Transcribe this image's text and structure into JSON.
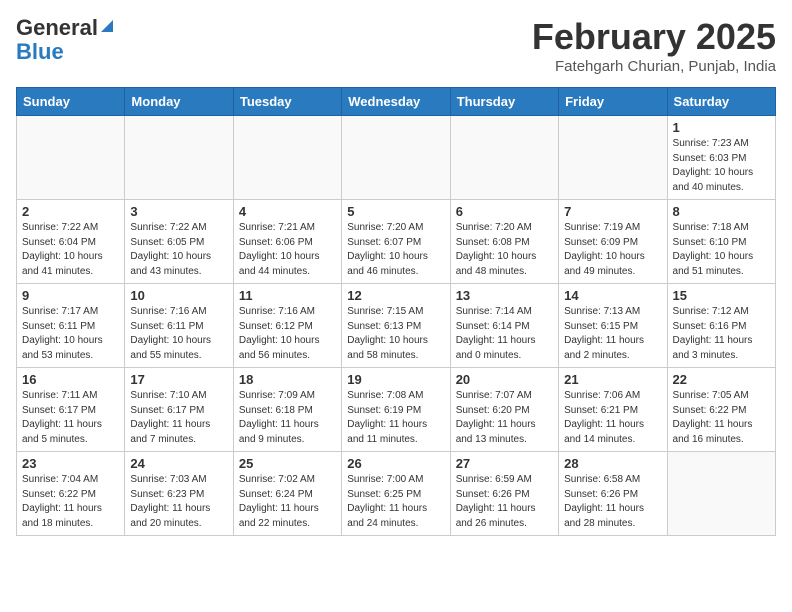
{
  "header": {
    "logo_general": "General",
    "logo_blue": "Blue",
    "title": "February 2025",
    "subtitle": "Fatehgarh Churian, Punjab, India"
  },
  "weekdays": [
    "Sunday",
    "Monday",
    "Tuesday",
    "Wednesday",
    "Thursday",
    "Friday",
    "Saturday"
  ],
  "weeks": [
    [
      {
        "day": "",
        "info": ""
      },
      {
        "day": "",
        "info": ""
      },
      {
        "day": "",
        "info": ""
      },
      {
        "day": "",
        "info": ""
      },
      {
        "day": "",
        "info": ""
      },
      {
        "day": "",
        "info": ""
      },
      {
        "day": "1",
        "info": "Sunrise: 7:23 AM\nSunset: 6:03 PM\nDaylight: 10 hours\nand 40 minutes."
      }
    ],
    [
      {
        "day": "2",
        "info": "Sunrise: 7:22 AM\nSunset: 6:04 PM\nDaylight: 10 hours\nand 41 minutes."
      },
      {
        "day": "3",
        "info": "Sunrise: 7:22 AM\nSunset: 6:05 PM\nDaylight: 10 hours\nand 43 minutes."
      },
      {
        "day": "4",
        "info": "Sunrise: 7:21 AM\nSunset: 6:06 PM\nDaylight: 10 hours\nand 44 minutes."
      },
      {
        "day": "5",
        "info": "Sunrise: 7:20 AM\nSunset: 6:07 PM\nDaylight: 10 hours\nand 46 minutes."
      },
      {
        "day": "6",
        "info": "Sunrise: 7:20 AM\nSunset: 6:08 PM\nDaylight: 10 hours\nand 48 minutes."
      },
      {
        "day": "7",
        "info": "Sunrise: 7:19 AM\nSunset: 6:09 PM\nDaylight: 10 hours\nand 49 minutes."
      },
      {
        "day": "8",
        "info": "Sunrise: 7:18 AM\nSunset: 6:10 PM\nDaylight: 10 hours\nand 51 minutes."
      }
    ],
    [
      {
        "day": "9",
        "info": "Sunrise: 7:17 AM\nSunset: 6:11 PM\nDaylight: 10 hours\nand 53 minutes."
      },
      {
        "day": "10",
        "info": "Sunrise: 7:16 AM\nSunset: 6:11 PM\nDaylight: 10 hours\nand 55 minutes."
      },
      {
        "day": "11",
        "info": "Sunrise: 7:16 AM\nSunset: 6:12 PM\nDaylight: 10 hours\nand 56 minutes."
      },
      {
        "day": "12",
        "info": "Sunrise: 7:15 AM\nSunset: 6:13 PM\nDaylight: 10 hours\nand 58 minutes."
      },
      {
        "day": "13",
        "info": "Sunrise: 7:14 AM\nSunset: 6:14 PM\nDaylight: 11 hours\nand 0 minutes."
      },
      {
        "day": "14",
        "info": "Sunrise: 7:13 AM\nSunset: 6:15 PM\nDaylight: 11 hours\nand 2 minutes."
      },
      {
        "day": "15",
        "info": "Sunrise: 7:12 AM\nSunset: 6:16 PM\nDaylight: 11 hours\nand 3 minutes."
      }
    ],
    [
      {
        "day": "16",
        "info": "Sunrise: 7:11 AM\nSunset: 6:17 PM\nDaylight: 11 hours\nand 5 minutes."
      },
      {
        "day": "17",
        "info": "Sunrise: 7:10 AM\nSunset: 6:17 PM\nDaylight: 11 hours\nand 7 minutes."
      },
      {
        "day": "18",
        "info": "Sunrise: 7:09 AM\nSunset: 6:18 PM\nDaylight: 11 hours\nand 9 minutes."
      },
      {
        "day": "19",
        "info": "Sunrise: 7:08 AM\nSunset: 6:19 PM\nDaylight: 11 hours\nand 11 minutes."
      },
      {
        "day": "20",
        "info": "Sunrise: 7:07 AM\nSunset: 6:20 PM\nDaylight: 11 hours\nand 13 minutes."
      },
      {
        "day": "21",
        "info": "Sunrise: 7:06 AM\nSunset: 6:21 PM\nDaylight: 11 hours\nand 14 minutes."
      },
      {
        "day": "22",
        "info": "Sunrise: 7:05 AM\nSunset: 6:22 PM\nDaylight: 11 hours\nand 16 minutes."
      }
    ],
    [
      {
        "day": "23",
        "info": "Sunrise: 7:04 AM\nSunset: 6:22 PM\nDaylight: 11 hours\nand 18 minutes."
      },
      {
        "day": "24",
        "info": "Sunrise: 7:03 AM\nSunset: 6:23 PM\nDaylight: 11 hours\nand 20 minutes."
      },
      {
        "day": "25",
        "info": "Sunrise: 7:02 AM\nSunset: 6:24 PM\nDaylight: 11 hours\nand 22 minutes."
      },
      {
        "day": "26",
        "info": "Sunrise: 7:00 AM\nSunset: 6:25 PM\nDaylight: 11 hours\nand 24 minutes."
      },
      {
        "day": "27",
        "info": "Sunrise: 6:59 AM\nSunset: 6:26 PM\nDaylight: 11 hours\nand 26 minutes."
      },
      {
        "day": "28",
        "info": "Sunrise: 6:58 AM\nSunset: 6:26 PM\nDaylight: 11 hours\nand 28 minutes."
      },
      {
        "day": "",
        "info": ""
      }
    ]
  ]
}
